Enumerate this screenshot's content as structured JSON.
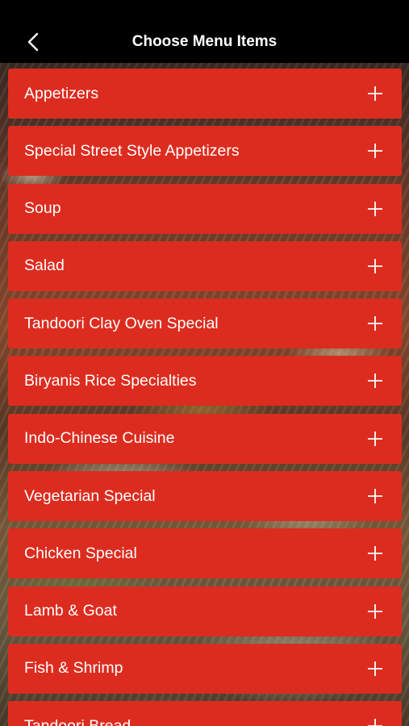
{
  "header": {
    "title": "Choose Menu Items",
    "back_icon": "chevron-left-icon"
  },
  "colors": {
    "nav_bg": "#000000",
    "item_bg": "#dc2c1f",
    "text": "#ffffff"
  },
  "menu": {
    "expand_icon": "plus-icon",
    "items": [
      {
        "label": "Appetizers"
      },
      {
        "label": "Special Street Style Appetizers"
      },
      {
        "label": "Soup"
      },
      {
        "label": "Salad"
      },
      {
        "label": "Tandoori Clay Oven Special"
      },
      {
        "label": "Biryanis Rice Specialties"
      },
      {
        "label": "Indo-Chinese Cuisine"
      },
      {
        "label": "Vegetarian Special"
      },
      {
        "label": "Chicken Special"
      },
      {
        "label": "Lamb & Goat"
      },
      {
        "label": "Fish & Shrimp"
      },
      {
        "label": "Tandoori Bread"
      }
    ]
  }
}
